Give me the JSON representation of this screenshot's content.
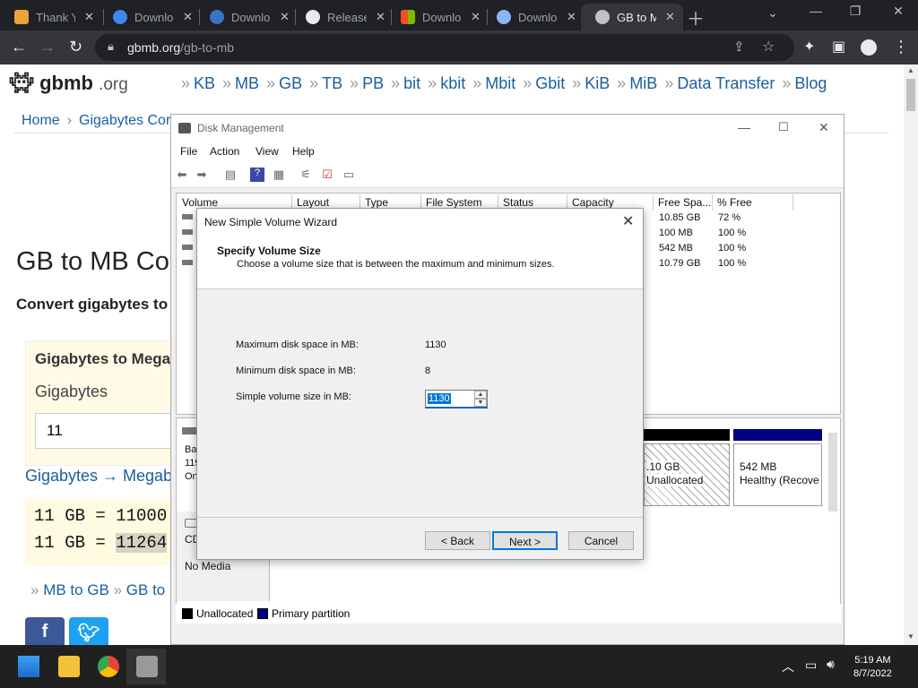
{
  "browser": {
    "tabs": [
      {
        "label": "Thank Y",
        "color": "#e8a33c"
      },
      {
        "label": "Downlo",
        "color": "#4285f4"
      },
      {
        "label": "Downlo",
        "color": "#3b73c4"
      },
      {
        "label": "Release",
        "color": "#e8eaed"
      },
      {
        "label": "Downlo",
        "color": "#f25022"
      },
      {
        "label": "Downlo",
        "color": "#8ab4f8"
      },
      {
        "label": "GB to M",
        "color": "#c2c2c2"
      }
    ],
    "url_host": "gbmb.org",
    "url_path": "/gb-to-mb"
  },
  "site": {
    "logo": "gbmb",
    "logo_suffix": ".org",
    "nav": [
      "KB",
      "MB",
      "GB",
      "TB",
      "PB",
      "bit",
      "kbit",
      "Mbit",
      "Gbit",
      "KiB",
      "MiB",
      "Data Transfer",
      "Blog"
    ],
    "breadcrumb_home": "Home",
    "breadcrumb_current": "Gigabytes Cor",
    "heading": "GB to MB Cor",
    "subheading": "Convert gigabytes to",
    "converter_title": "Gigabytes to Mega",
    "converter_label": "Gigabytes",
    "converter_value": "11",
    "conversion_link": "Gigabytes → Megab",
    "result1": "11 GB = 11000",
    "result2_prefix": "11 GB = ",
    "result2_value": "11264",
    "related_links": [
      "MB to GB",
      "GB to"
    ]
  },
  "disk_mgmt": {
    "title": "Disk Management",
    "menu": [
      "File",
      "Action",
      "View",
      "Help"
    ],
    "columns": [
      "Volume",
      "Layout",
      "Type",
      "File System",
      "Status",
      "Capacity",
      "Free Spa...",
      "% Free"
    ],
    "rows": [
      {
        "free": "10.85 GB",
        "pct": "72 %"
      },
      {
        "free": "100 MB",
        "pct": "100 %"
      },
      {
        "free": "542 MB",
        "pct": "100 %"
      },
      {
        "free": "10.79 GB",
        "pct": "100 %"
      }
    ],
    "disk0_label_lines": [
      "Bas",
      "119",
      "On"
    ],
    "unalloc_size": ".10 GB",
    "unalloc_label": "Unallocated",
    "recovery_size": "542 MB",
    "recovery_label": "Healthy (Recove",
    "cd_label": "CD",
    "cd_status": "No Media",
    "legend": [
      {
        "label": "Unallocated",
        "color": "#000000"
      },
      {
        "label": "Primary partition",
        "color": "#000080"
      }
    ]
  },
  "wizard": {
    "title": "New Simple Volume Wizard",
    "heading": "Specify Volume Size",
    "description": "Choose a volume size that is between the maximum and minimum sizes.",
    "max_label": "Maximum disk space in MB:",
    "max_value": "1130",
    "min_label": "Minimum disk space in MB:",
    "min_value": "8",
    "size_label": "Simple volume size in MB:",
    "size_value": "1130",
    "back": "< Back",
    "next": "Next >",
    "cancel": "Cancel"
  },
  "taskbar": {
    "time": "5:19 AM",
    "date": "8/7/2022"
  }
}
